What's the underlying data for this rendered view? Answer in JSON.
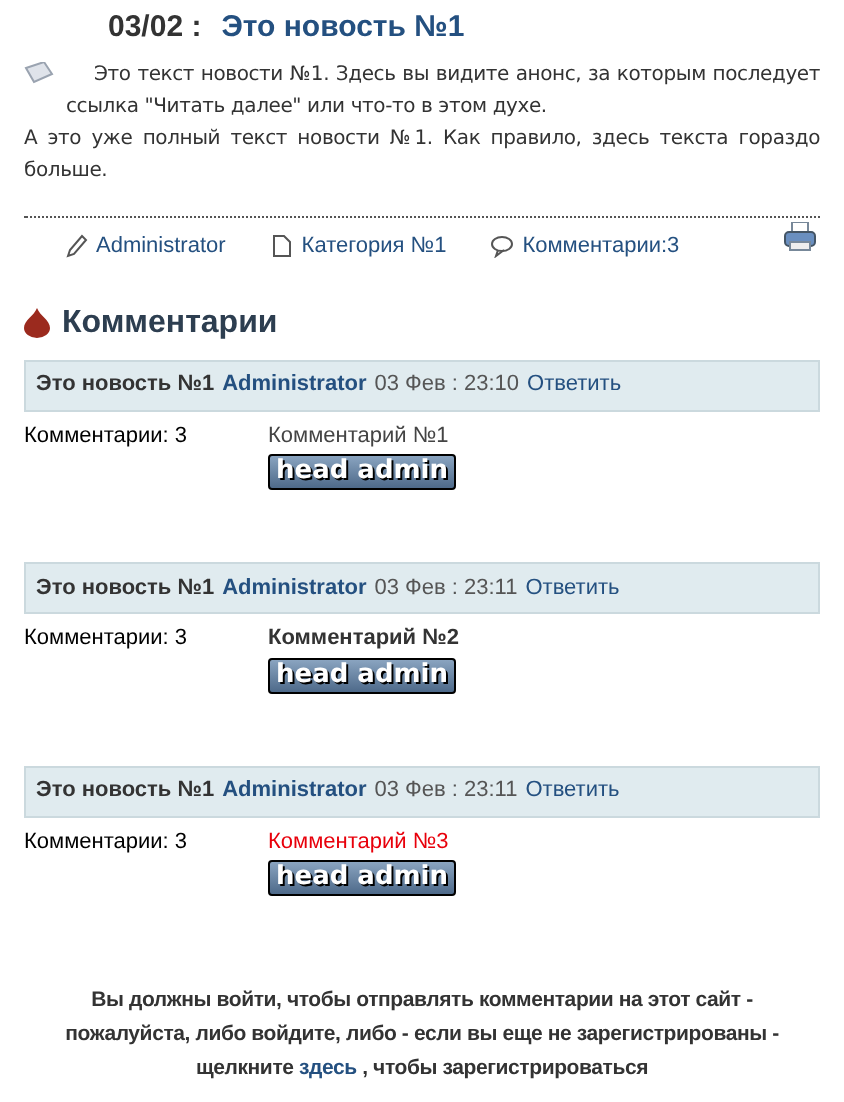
{
  "news": {
    "date": "03/02 :",
    "title": "Это новость №1",
    "intro": "Это текст новости №1. Здесь вы видите анонс, за которым последует ссылка \"Читать далее\" или что-то в этом духе.",
    "full": "А это уже полный текст новости №1. Как правило, здесь текста гораздо больше.",
    "meta": [
      {
        "kind": "author",
        "label": "Administrator"
      },
      {
        "kind": "category",
        "label": "Категория №1"
      },
      {
        "kind": "comments",
        "label": "Комментарии:3"
      }
    ]
  },
  "comments_heading": "Комментарии",
  "comments": [
    {
      "news": "Это новость №1",
      "author": "Administrator",
      "date": "03 Фев : 23:10",
      "reply": "Ответить",
      "count": "Комментарии: 3",
      "text": "Комментарий №1",
      "kind": "normal",
      "badge": "head admin"
    },
    {
      "news": "Это новость №1",
      "author": "Administrator",
      "date": "03 Фев : 23:11",
      "reply": "Ответить",
      "count": "Комментарии: 3",
      "text": "Комментарий №2",
      "kind": "bold",
      "badge": "head admin"
    },
    {
      "news": "Это новость №1",
      "author": "Administrator",
      "date": "03 Фев : 23:11",
      "reply": "Ответить",
      "count": "Комментарии: 3",
      "text": "Комментарий №3",
      "kind": "red",
      "badge": "head admin"
    }
  ],
  "login_notice": {
    "before": "Вы должны войти, чтобы отправлять комментарии на этот сайт - пожалуйста, либо войдите, либо - если вы еще не зарегистрированы - щелкните",
    "link": "здесь",
    "after": ", чтобы зарегистрироваться"
  }
}
